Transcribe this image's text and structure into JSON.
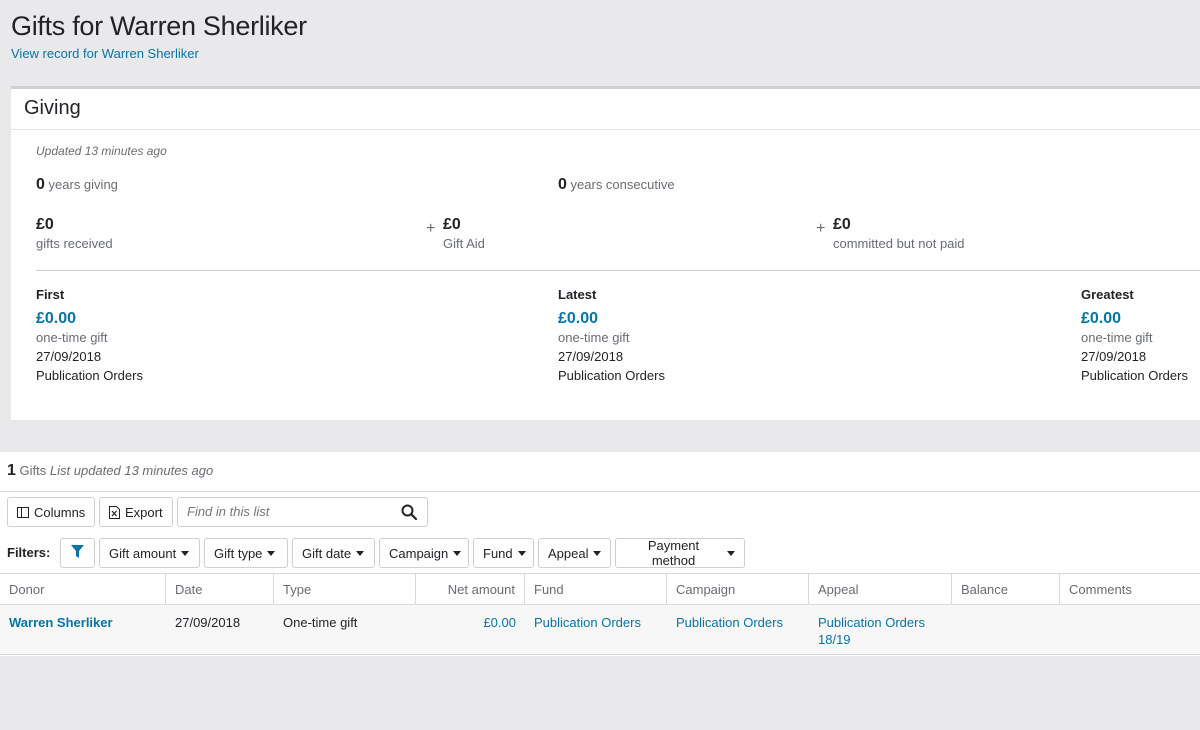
{
  "header": {
    "title": "Gifts for Warren Sherliker",
    "record_link": "View record for Warren Sherliker"
  },
  "giving": {
    "title": "Giving",
    "updated": "Updated 13 minutes ago",
    "years_giving": {
      "value": "0",
      "label": "years giving"
    },
    "years_consecutive": {
      "value": "0",
      "label": "years consecutive"
    },
    "gifts_received": {
      "value": "£0",
      "label": "gifts received"
    },
    "gift_aid": {
      "prefix": "+",
      "value": "£0",
      "label": "Gift Aid"
    },
    "committed": {
      "prefix": "+",
      "value": "£0",
      "label": "committed but not paid"
    },
    "first": {
      "heading": "First",
      "amount": "£0.00",
      "type": "one-time gift",
      "date": "27/09/2018",
      "campaign": "Publication Orders"
    },
    "latest": {
      "heading": "Latest",
      "amount": "£0.00",
      "type": "one-time gift",
      "date": "27/09/2018",
      "campaign": "Publication Orders"
    },
    "greatest": {
      "heading": "Greatest",
      "amount": "£0.00",
      "type": "one-time gift",
      "date": "27/09/2018",
      "campaign": "Publication Orders"
    }
  },
  "list": {
    "count": "1",
    "count_label": "Gifts",
    "updated": "List updated 13 minutes ago",
    "toolbar": {
      "columns_label": "Columns",
      "export_label": "Export",
      "search_placeholder": "Find in this list"
    },
    "filters_label": "Filters:",
    "filters": [
      "Gift amount",
      "Gift type",
      "Gift date",
      "Campaign",
      "Fund",
      "Appeal",
      "Payment method"
    ],
    "columns": [
      "Donor",
      "Date",
      "Type",
      "Net amount",
      "Fund",
      "Campaign",
      "Appeal",
      "Balance",
      "Comments"
    ],
    "rows": [
      {
        "donor": "Warren Sherliker",
        "date": "27/09/2018",
        "type": "One-time gift",
        "net_amount": "£0.00",
        "fund": "Publication Orders",
        "campaign": "Publication Orders",
        "appeal": "Publication Orders 18/19",
        "balance": "",
        "comments": ""
      }
    ]
  },
  "colors": {
    "link": "#0974a1",
    "background": "#e9e9eb",
    "muted_text": "#686c73"
  }
}
